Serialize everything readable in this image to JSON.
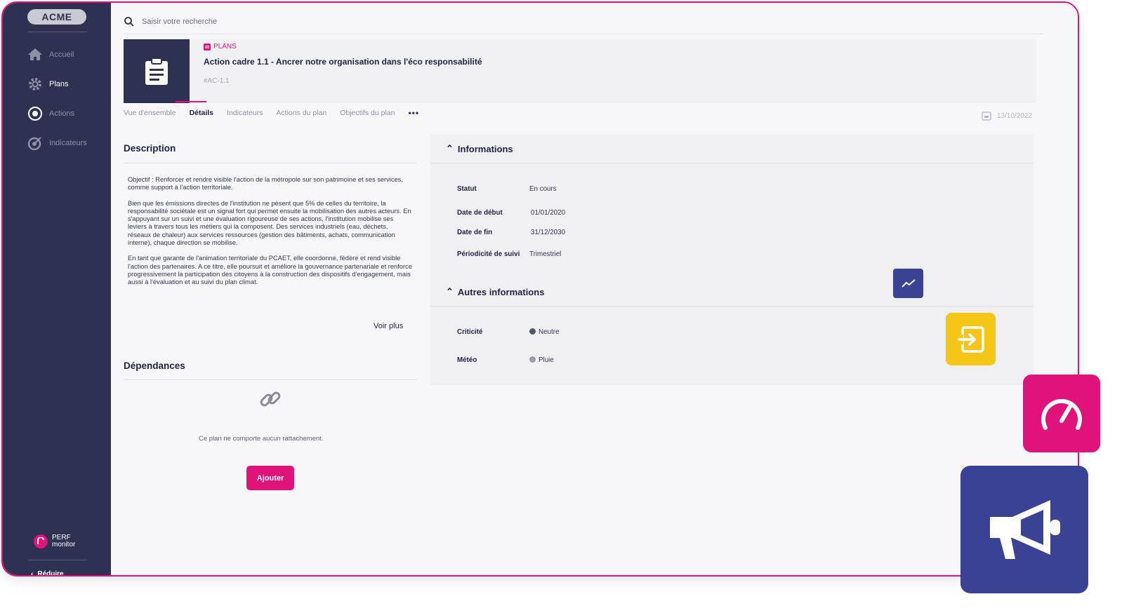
{
  "app": {
    "logo": "ACME",
    "nav": [
      {
        "label": "Accueil",
        "icon": "home-icon",
        "active": false
      },
      {
        "label": "Plans",
        "icon": "gear-icon",
        "active": true
      },
      {
        "label": "Actions",
        "icon": "target-icon",
        "active": false
      },
      {
        "label": "Indicateurs",
        "icon": "dart-icon",
        "active": false
      }
    ],
    "brand_line1": "PERF",
    "brand_line2": "monitor",
    "reduce_label": "Réduire"
  },
  "search": {
    "placeholder": "Saisir votre recherche"
  },
  "header": {
    "tag": "PLANS",
    "title": "Action cadre 1.1 - Ancrer notre organisation dans l'éco responsabilité",
    "code": "#AC-1.1"
  },
  "tabs": {
    "items": [
      "Vue d'ensemble",
      "Détails",
      "Indicateurs",
      "Actions du plan",
      "Objectifs du plan"
    ],
    "active_index": 1,
    "more": "•••"
  },
  "date": "13/10/2022",
  "description": {
    "title": "Description",
    "paragraphs": [
      "Objectif : Renforcer et rendre visible l'action de la métropole sur son patrimoine et ses services, comme support à l'action territoriale.",
      "Bien que les émissions directes de l'institution ne pèsent que 5% de celles du territoire, la responsabilité sociétale est un signal fort qui permet ensuite la mobilisation des autres acteurs. En s'appuyant sur un suivi et une évaluation rigoureuse de ses actions, l'institution mobilise ses leviers à travers tous les métiers qui la composent. Des services industriels (eau, déchets, réseaux de chaleur) aux services ressources (gestion des bâtiments, achats, communication interne), chaque direction se mobilise.",
      "En tant que garante de l'animation territoriale du PCAET, elle coordonne, fédère et rend visible l'action des partenaires. A ce titre, elle poursuit et améliore la gouvernance partenariale et renforce progressivement la participation des citoyens à la construction des dispositifs d'engagement, mais aussi à l'évaluation et au suivi du plan climat."
    ],
    "more_label": "Voir plus"
  },
  "dependencies": {
    "title": "Dépendances",
    "empty_text": "Ce plan ne comporte aucun rattachement.",
    "add_label": "Ajouter"
  },
  "informations": {
    "title": "Informations",
    "rows": [
      {
        "label": "Statut",
        "value": "En cours"
      },
      {
        "label": "Date de début",
        "value": "01/01/2020"
      },
      {
        "label": "Date de fin",
        "value": "31/12/2030"
      },
      {
        "label": "Périodicité de suivi",
        "value": "Trimestriel"
      }
    ]
  },
  "other": {
    "title": "Autres informations",
    "rows": [
      {
        "label": "Criticité",
        "value": "Neutre",
        "dot_color": "#555766"
      },
      {
        "label": "Météo",
        "value": "Pluie",
        "dot_color": "#9c9ca6"
      }
    ]
  },
  "colors": {
    "accent": "#e0137a",
    "sidebar": "#2f3152",
    "blue_tile": "#3a4294",
    "yellow_tile": "#f5c518"
  }
}
